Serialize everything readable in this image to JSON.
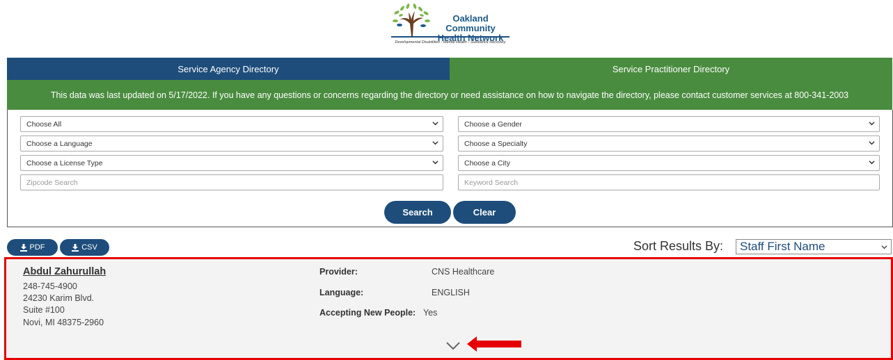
{
  "logo": {
    "title_line1": "Oakland Community",
    "title_line2": "Health Network",
    "tagline": "Developmental Disabilities - Mental Health - Substance Recovery"
  },
  "tabs": [
    {
      "label": "Service Agency Directory"
    },
    {
      "label": "Service Practitioner Directory"
    }
  ],
  "notice": "This data was last updated on 5/17/2022. If you have any questions or concerns regarding the directory or need assistance on how to navigate the directory, please contact customer services at 800-341-2003",
  "filters": {
    "category": "Choose All",
    "gender": "Choose a Gender",
    "language": "Choose a Language",
    "specialty": "Choose a Specialty",
    "license": "Choose a License Type",
    "city": "Choose a City",
    "zip_placeholder": "Zipcode Search",
    "keyword_placeholder": "Keyword Search"
  },
  "buttons": {
    "search": "Search",
    "clear": "Clear",
    "pdf": "PDF",
    "csv": "CSV"
  },
  "sort": {
    "label": "Sort Results By:",
    "selected": "Staff First Name"
  },
  "result": {
    "name": "Abdul Zahurullah",
    "phone": "248-745-4900",
    "address1": "24230 Karim Blvd.",
    "address2": "Suite #100",
    "city_state_zip": "Novi, MI 48375-2960",
    "provider_label": "Provider:",
    "provider": "CNS Healthcare",
    "language_label": "Language:",
    "language": "ENGLISH",
    "accepting_label": "Accepting New People:",
    "accepting": "Yes"
  },
  "colors": {
    "navy": "#1e4d7b",
    "green": "#4a8c3f",
    "highlight_red": "#e60000"
  }
}
